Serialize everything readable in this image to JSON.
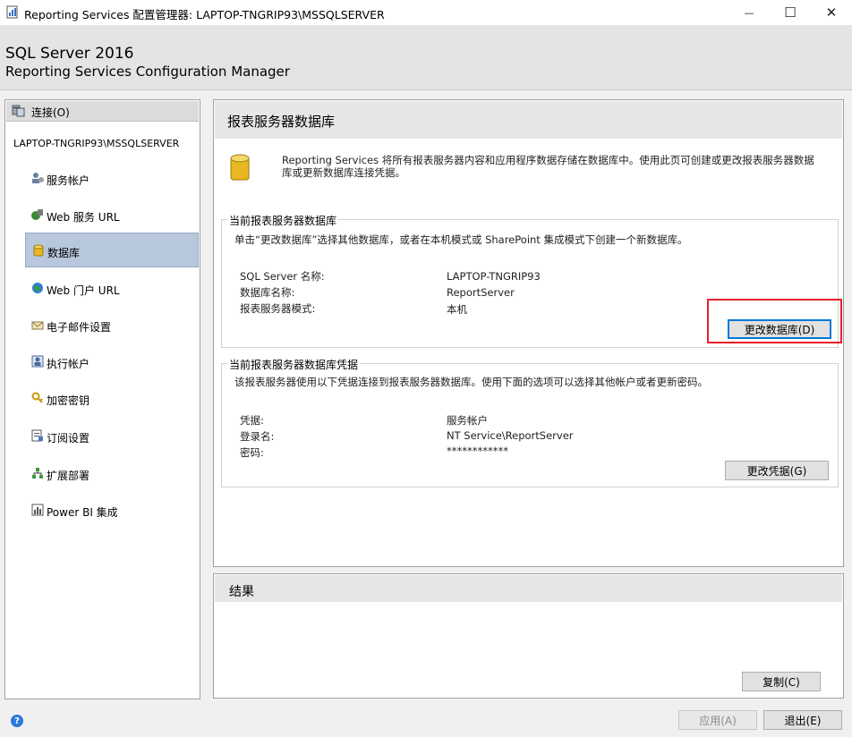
{
  "window": {
    "title": "Reporting Services 配置管理器: LAPTOP-TNGRIP93\\MSSQLSERVER",
    "minimize_glyph": "—",
    "maximize_glyph": "☐",
    "close_glyph": "✕"
  },
  "banner": {
    "product": "SQL Server 2016",
    "subtitle": "Reporting Services Configuration Manager"
  },
  "nav": {
    "connect_label": "连接(O)",
    "server": "LAPTOP-TNGRIP93\\MSSQLSERVER",
    "items": [
      {
        "label": "服务帐户",
        "icon": "service-account-icon"
      },
      {
        "label": "Web 服务 URL",
        "icon": "web-service-icon"
      },
      {
        "label": "数据库",
        "icon": "database-icon",
        "selected": true
      },
      {
        "label": "Web 门户 URL",
        "icon": "globe-icon"
      },
      {
        "label": "电子邮件设置",
        "icon": "email-icon"
      },
      {
        "label": "执行帐户",
        "icon": "execution-account-icon"
      },
      {
        "label": "加密密钥",
        "icon": "key-icon"
      },
      {
        "label": "订阅设置",
        "icon": "subscription-icon"
      },
      {
        "label": "扩展部署",
        "icon": "scale-out-icon"
      },
      {
        "label": "Power BI 集成",
        "icon": "powerbi-icon"
      }
    ]
  },
  "main": {
    "title": "报表服务器数据库",
    "description": "Reporting Services 将所有报表服务器内容和应用程序数据存储在数据库中。使用此页可创建或更改报表服务器数据库或更新数据库连接凭据。",
    "current_db": {
      "legend": "当前报表服务器数据库",
      "hint": "单击“更改数据库”选择其他数据库，或者在本机模式或 SharePoint 集成模式下创建一个新数据库。",
      "rows": [
        {
          "label": "SQL Server 名称:",
          "value": "LAPTOP-TNGRIP93"
        },
        {
          "label": "数据库名称:",
          "value": "ReportServer"
        },
        {
          "label": "报表服务器模式:",
          "value": "本机"
        }
      ],
      "button": "更改数据库(D)"
    },
    "credentials": {
      "legend": "当前报表服务器数据库凭据",
      "hint": "该报表服务器使用以下凭据连接到报表服务器数据库。使用下面的选项可以选择其他帐户或者更新密码。",
      "rows": [
        {
          "label": "凭据:",
          "value": "服务帐户"
        },
        {
          "label": "登录名:",
          "value": "NT Service\\ReportServer"
        },
        {
          "label": "密码:",
          "value": "************"
        }
      ],
      "button": "更改凭据(G)"
    }
  },
  "results": {
    "title": "结果",
    "copy_button": "复制(C)"
  },
  "footer": {
    "help_glyph": "?",
    "apply_button": "应用(A)",
    "exit_button": "退出(E)"
  },
  "colors": {
    "highlight_box": "#e8202a",
    "nav_selected": "#b8c8dc",
    "focus_border": "#0078d7"
  }
}
